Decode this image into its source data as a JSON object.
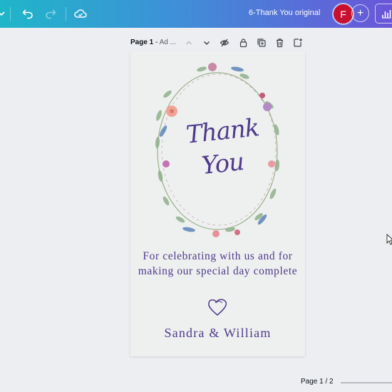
{
  "toolbar": {
    "doc_title": "6-Thank You original",
    "avatar_initial": "F",
    "add_label": "+",
    "icons": [
      "menu-chevron-icon",
      "undo-icon",
      "redo-icon",
      "cloud-save-icon",
      "insights-icon"
    ]
  },
  "page_header": {
    "page_label": "Page 1",
    "separator": " - ",
    "page_name": "Ad ...",
    "icons": [
      "chevron-up-icon",
      "chevron-down-icon",
      "hide-icon",
      "lock-icon",
      "duplicate-icon",
      "trash-icon",
      "add-page-icon"
    ]
  },
  "design": {
    "thank": "Thank",
    "you": "You",
    "message": "For celebrating with us and for making our special day complete",
    "names": "Sandra & William",
    "text_color": "#4f3a8c"
  },
  "footer": {
    "page_count": "Page 1 / 2"
  }
}
